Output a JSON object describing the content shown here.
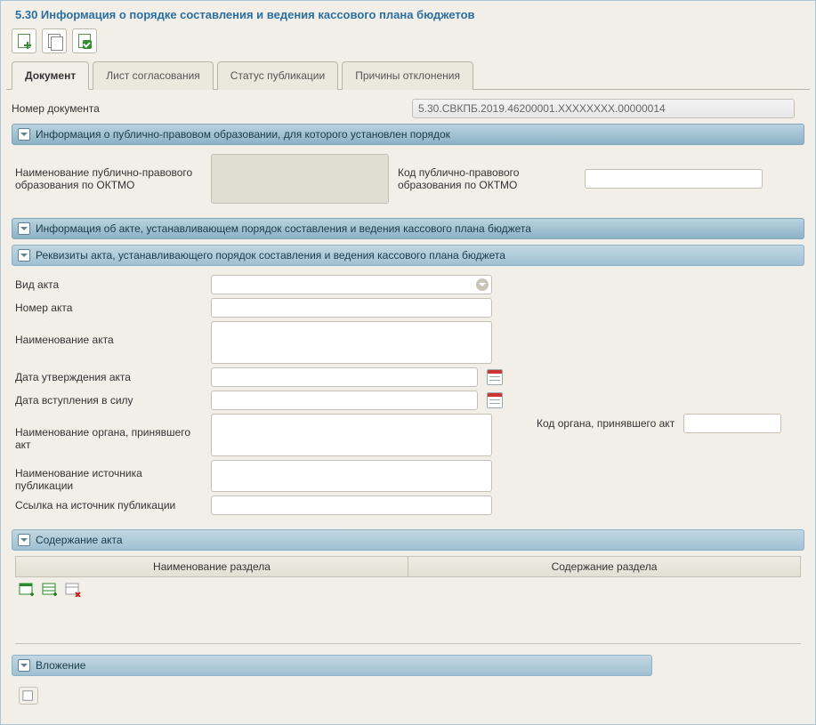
{
  "title": "5.30 Информация о порядке составления и ведения кассового плана бюджетов",
  "tabs": {
    "document": "Документ",
    "approval": "Лист согласования",
    "pub_status": "Статус публикации",
    "reject_reasons": "Причины отклонения"
  },
  "doc_number_label": "Номер документа",
  "doc_number_value": "5.30.СВКПБ.2019.46200001.XXXXXXXX.00000014",
  "sections": {
    "ppo": {
      "title": "Информация о публично-правовом образовании, для которого установлен порядок",
      "name_label": "Наименование публично-правового образования по ОКТМО",
      "code_label": "Код публично-правового образования по ОКТМО",
      "code_value": ""
    },
    "act_info": {
      "title": "Информация об акте, устанавливающем порядок составления и ведения кассового плана бюджета"
    },
    "act_req": {
      "title": "Реквизиты акта, устанавливающего порядок составления и ведения кассового плана бюджета",
      "kind_label": "Вид акта",
      "kind_value": "",
      "number_label": "Номер акта",
      "number_value": "",
      "name_label": "Наименование акта",
      "name_value": "",
      "approve_date_label": "Дата утверждения акта",
      "approve_date_value": "",
      "effect_date_label": "Дата вступления в силу",
      "effect_date_value": "",
      "authority_name_label": "Наименование органа, принявшего акт",
      "authority_name_value": "",
      "authority_code_label": "Код органа, принявшего акт",
      "authority_code_value": "",
      "source_name_label": "Наименование источника публикации",
      "source_name_value": "",
      "source_link_label": "Ссылка на источник публикации",
      "source_link_value": ""
    },
    "act_content": {
      "title": "Содержание акта",
      "col_name": "Наименование раздела",
      "col_content": "Содержание раздела"
    },
    "attachment": {
      "title": "Вложение"
    }
  }
}
